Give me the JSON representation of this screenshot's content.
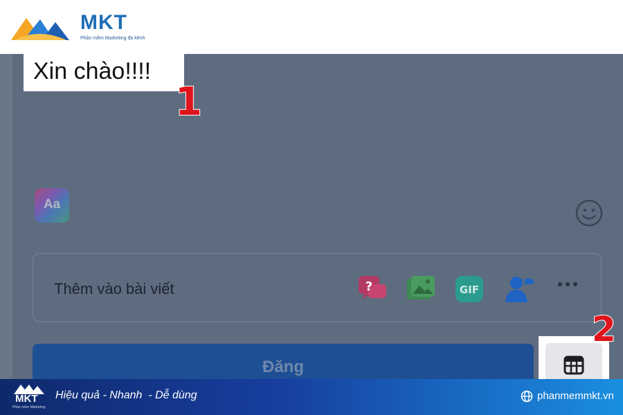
{
  "brand": {
    "name": "MKT",
    "tagline": "Phần mềm Marketing đa kênh",
    "colors": {
      "primary": "#1f6fb6",
      "accent": "#f5a623"
    }
  },
  "editor": {
    "post_text": "Xin chào!!!!",
    "text_style_button": "Aa",
    "emoji_icon": "smiley-icon"
  },
  "callouts": {
    "first": "1",
    "second": "2"
  },
  "add_to_post": {
    "label": "Thêm vào bài viết",
    "icons": [
      {
        "name": "qa-icon",
        "color": "#e0396a"
      },
      {
        "name": "photo-icon",
        "color": "#45bd62"
      },
      {
        "name": "gif-icon",
        "text": "GIF",
        "color": "#2abba7"
      },
      {
        "name": "tag-people-icon",
        "color": "#1877f2"
      },
      {
        "name": "more-icon",
        "text": "•••"
      }
    ]
  },
  "post_button": {
    "label": "Đăng"
  },
  "schedule_button": {
    "icon": "calendar-icon"
  },
  "footer": {
    "logo": "MKT",
    "logo_tag": "Phần mềm Marketing",
    "slogan": "Hiệu quả - Nhanh  - Dễ dùng",
    "website": "phanmemmkt.vn"
  }
}
